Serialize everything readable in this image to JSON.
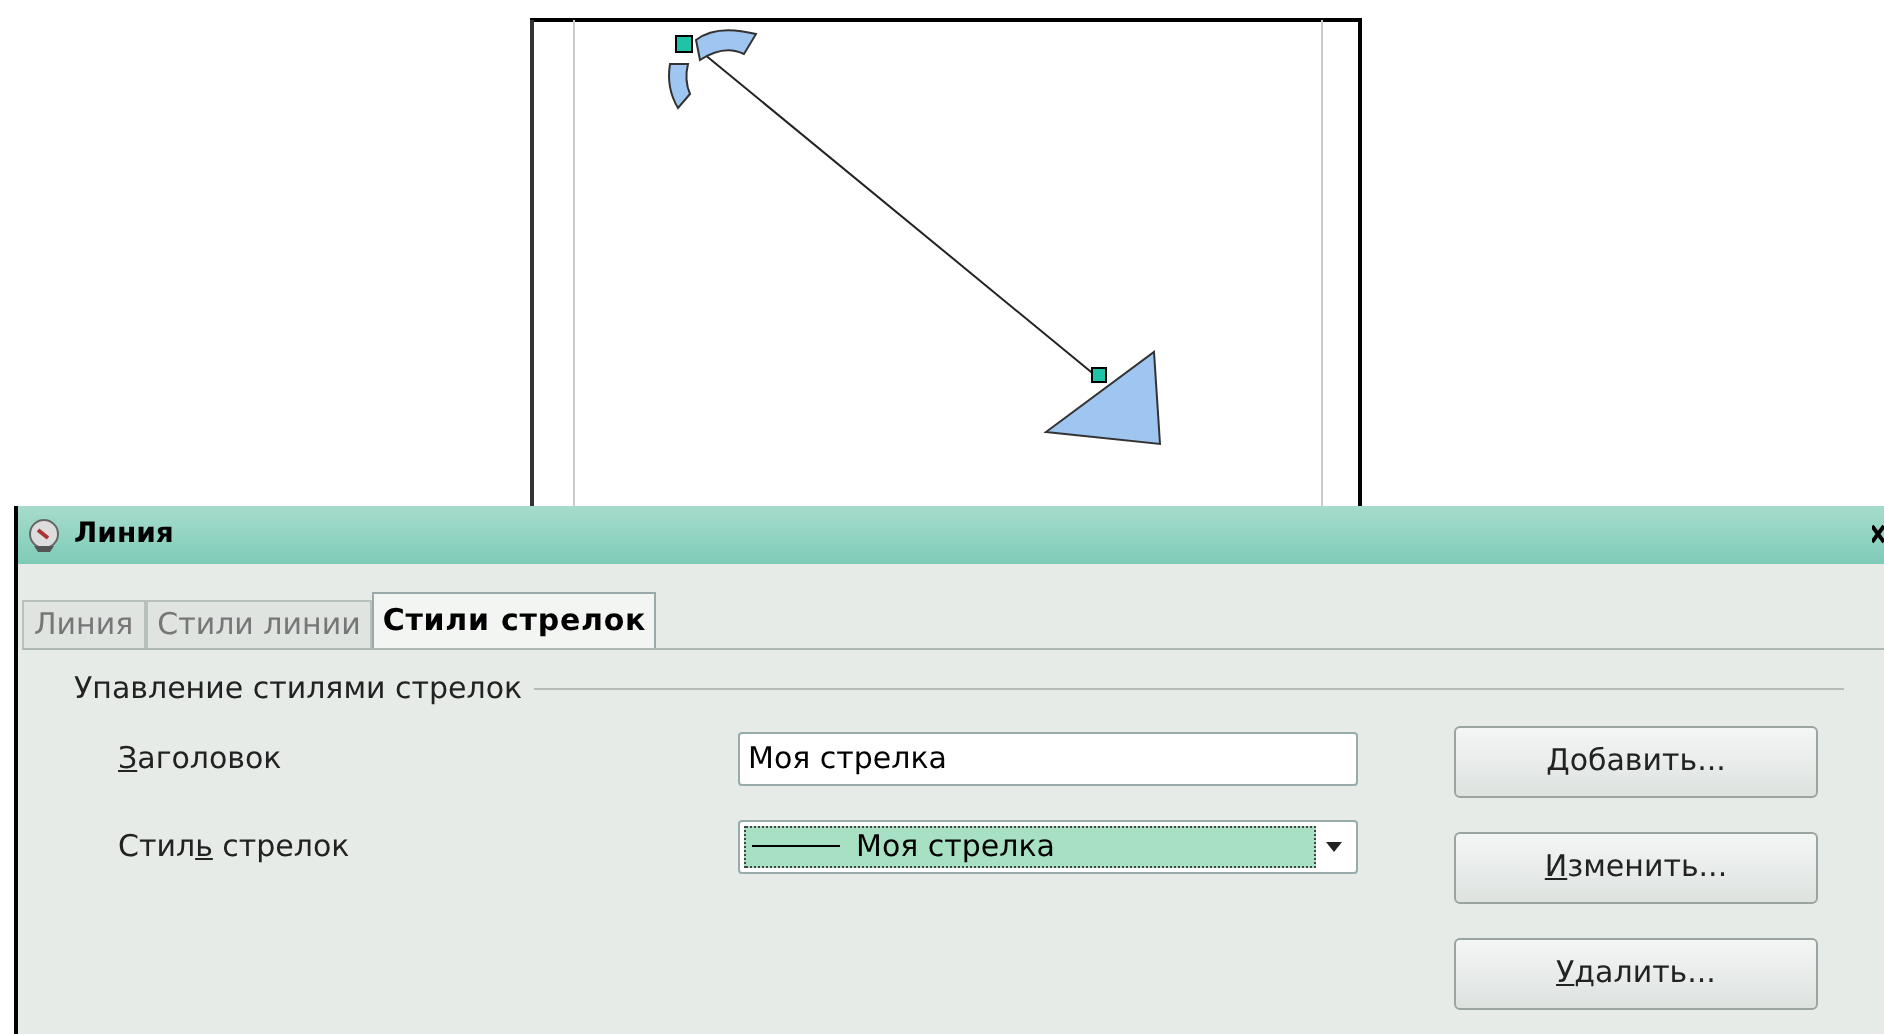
{
  "dialog": {
    "title": "Линия"
  },
  "tabs": [
    {
      "label": "Линия",
      "selected": false
    },
    {
      "label": "Стили линии",
      "selected": false
    },
    {
      "label": "Стили стрелок",
      "selected": true
    }
  ],
  "group": {
    "title": "Упавление стилями стрелок",
    "fields": [
      {
        "kind": "text",
        "label": {
          "key": "З",
          "after": "аголовок"
        },
        "value": "Моя стрелка"
      },
      {
        "kind": "dropdown",
        "label": {
          "before": "Стил",
          "key": "ь",
          "after": " стрелок"
        },
        "value": "Моя стрелка"
      }
    ]
  },
  "buttons": [
    {
      "key": "Д",
      "after": "обавить..."
    },
    {
      "key": "И",
      "after": "зменить..."
    },
    {
      "key": "У",
      "after": "далить..."
    }
  ]
}
